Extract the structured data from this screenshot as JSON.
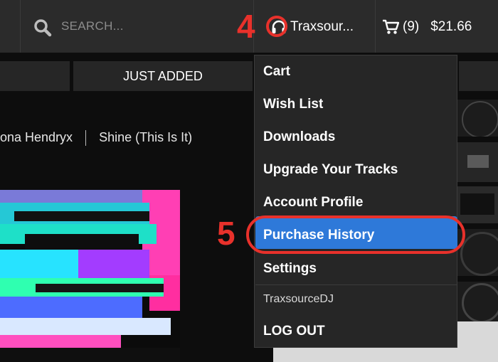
{
  "header": {
    "search": {
      "placeholder": "SEARCH..."
    },
    "user": {
      "name": "Traxsour..."
    },
    "cart": {
      "count": "(9)",
      "total": "$21.66"
    }
  },
  "nav": {
    "just_added": "JUST ADDED"
  },
  "release": {
    "artist": "ona Hendryx",
    "title": "Shine (This Is It)"
  },
  "dropdown": {
    "items": [
      {
        "label": "Cart"
      },
      {
        "label": "Wish List"
      },
      {
        "label": "Downloads"
      },
      {
        "label": "Upgrade Your Tracks"
      },
      {
        "label": "Account Profile"
      },
      {
        "label": "Purchase History",
        "highlighted": true
      },
      {
        "label": "Settings"
      }
    ],
    "username": "TraxsourceDJ",
    "logout": "LOG OUT"
  },
  "annotations": {
    "step4": "4",
    "step5": "5"
  },
  "colors": {
    "accent_blue": "#2e79d9",
    "annotation_red": "#e8312b",
    "topbar": "#2b2b2b"
  }
}
